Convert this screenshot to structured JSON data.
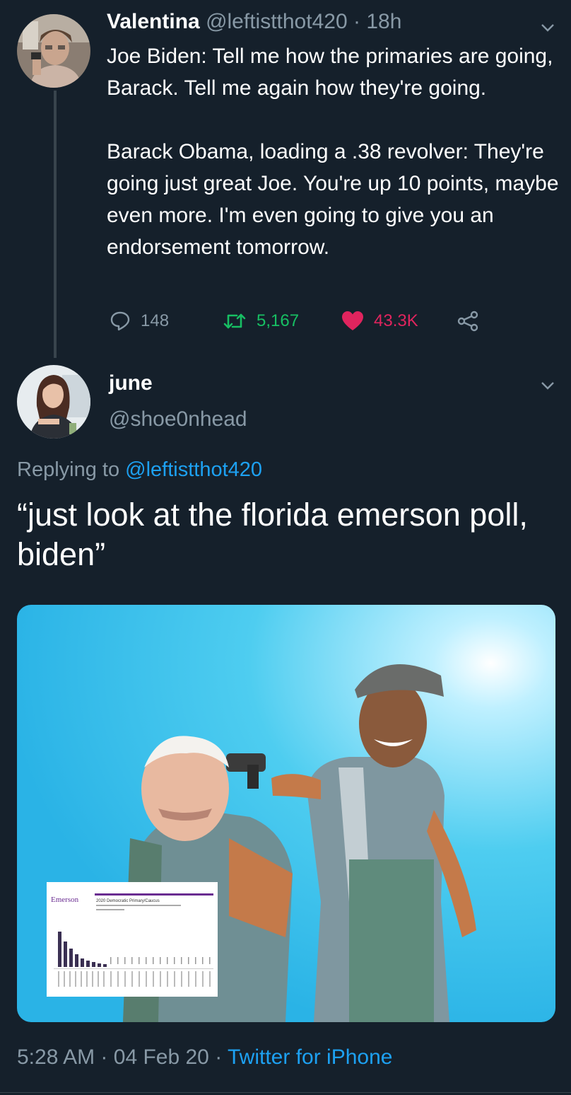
{
  "tweet1": {
    "display_name": "Valentina",
    "handle": "@leftistthot420",
    "separator": "·",
    "time": "18h",
    "paragraph1": "Joe Biden: Tell me how the primaries are going, Barack. Tell me again how they're going.",
    "paragraph2": "Barack Obama, loading a .38 revolver: They're going just great Joe. You're up 10 points, maybe even more. I'm even going to give you an endorsement tomorrow.",
    "replies": "148",
    "retweets": "5,167",
    "likes": "43.3K",
    "icons": [
      "reply-icon",
      "retweet-icon",
      "heart-icon",
      "share-icon",
      "chevron-down-icon"
    ],
    "colors": {
      "retweet": "#17bf63",
      "like": "#e0245e",
      "muted": "#8899a6"
    }
  },
  "tweet2": {
    "display_name": "june",
    "handle": "@shoe0nhead",
    "replying_prefix": "Replying to",
    "replying_handle": "@leftistthot420",
    "text": "“just look at the florida emerson poll, biden”",
    "media": {
      "chart_brand": "Emerson",
      "chart_title": "2020 Democratic Primary/Caucus"
    },
    "time": "5:28 AM",
    "separator1": "·",
    "date": "04 Feb 20",
    "separator2": "·",
    "source": "Twitter for iPhone"
  },
  "theme": {
    "background": "#15202b",
    "link": "#1da1f2",
    "divider": "#38444d"
  }
}
